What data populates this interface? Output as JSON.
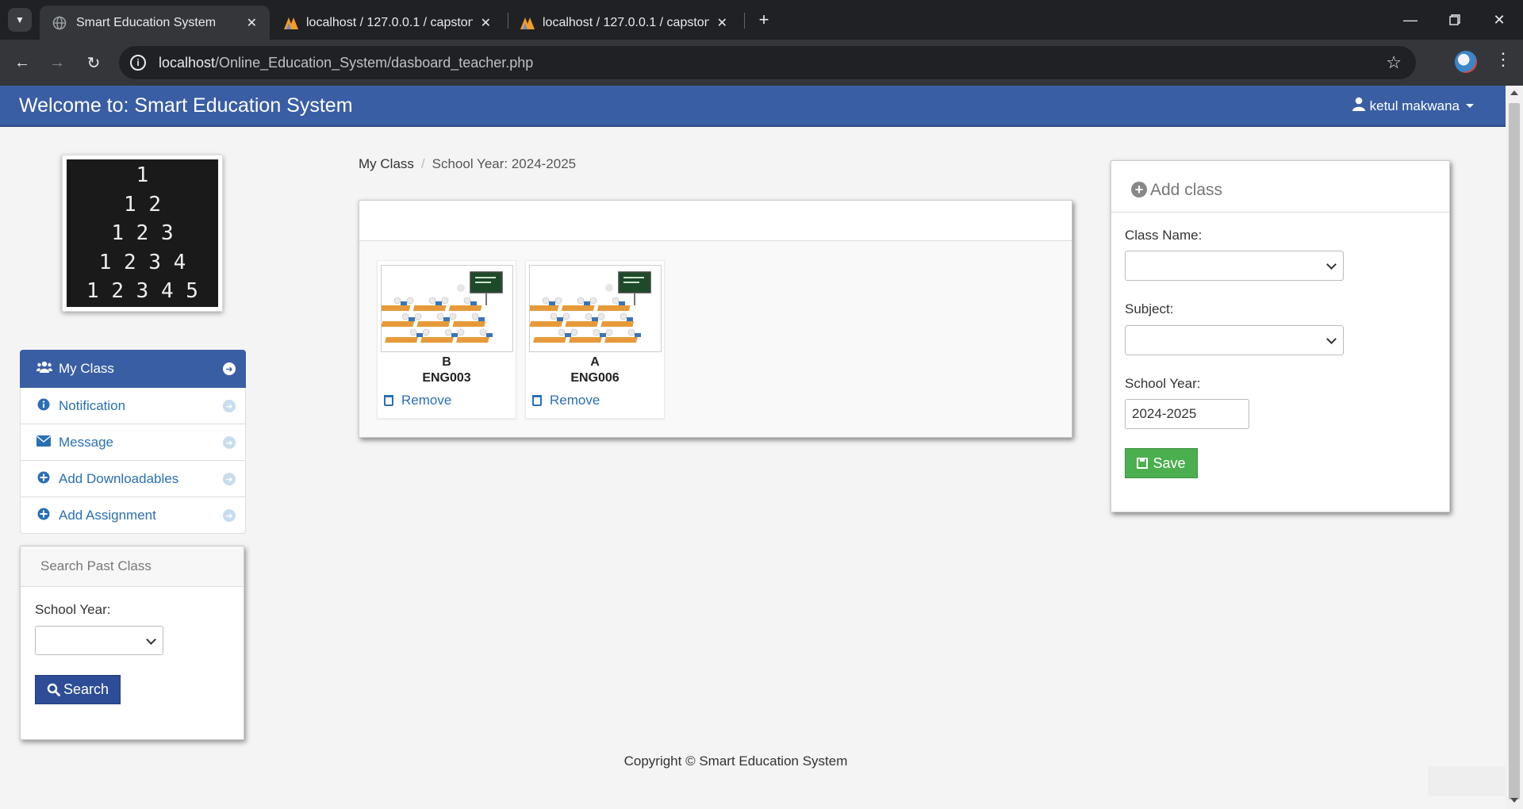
{
  "browser": {
    "tabs": [
      {
        "title": "Smart Education System",
        "active": true
      },
      {
        "title": "localhost / 127.0.0.1 / capstone",
        "active": false
      },
      {
        "title": "localhost / 127.0.0.1 / capstone",
        "active": false
      }
    ],
    "url_host": "localhost",
    "url_path": "/Online_Education_System/dasboard_teacher.php"
  },
  "header": {
    "brand": "Welcome to: Smart Education System",
    "user_name": "ketul makwana"
  },
  "logo": {
    "lines": [
      "1",
      "1 2",
      "1 2 3",
      "1 2 3 4",
      "1 2 3 4 5"
    ]
  },
  "sidebar": {
    "items": [
      {
        "label": "My Class",
        "icon": "users-icon",
        "active": true
      },
      {
        "label": "Notification",
        "icon": "info-icon",
        "active": false
      },
      {
        "label": "Message",
        "icon": "envelope-icon",
        "active": false
      },
      {
        "label": "Add Downloadables",
        "icon": "plus-circle-icon",
        "active": false
      },
      {
        "label": "Add Assignment",
        "icon": "plus-circle-icon",
        "active": false
      }
    ]
  },
  "search_panel": {
    "title": "Search Past Class",
    "school_year_label": "School Year:",
    "school_year_value": "",
    "button": "Search"
  },
  "breadcrumb": {
    "root": "My Class",
    "current": "School Year: 2024-2025"
  },
  "classes": [
    {
      "section": "B",
      "code": "ENG003",
      "remove": "Remove"
    },
    {
      "section": "A",
      "code": "ENG006",
      "remove": "Remove"
    }
  ],
  "add_class": {
    "title": "Add class",
    "class_name_label": "Class Name:",
    "class_name_value": "",
    "subject_label": "Subject:",
    "subject_value": "",
    "school_year_label": "School Year:",
    "school_year_value": "2024-2025",
    "save_button": "Save"
  },
  "footer": {
    "copyright": "Copyright © Smart Education System"
  },
  "colors": {
    "header_bg": "#3a5ea4",
    "link": "#2a6fb5",
    "save_green": "#4bae4f",
    "search_blue": "#2d4e96"
  }
}
